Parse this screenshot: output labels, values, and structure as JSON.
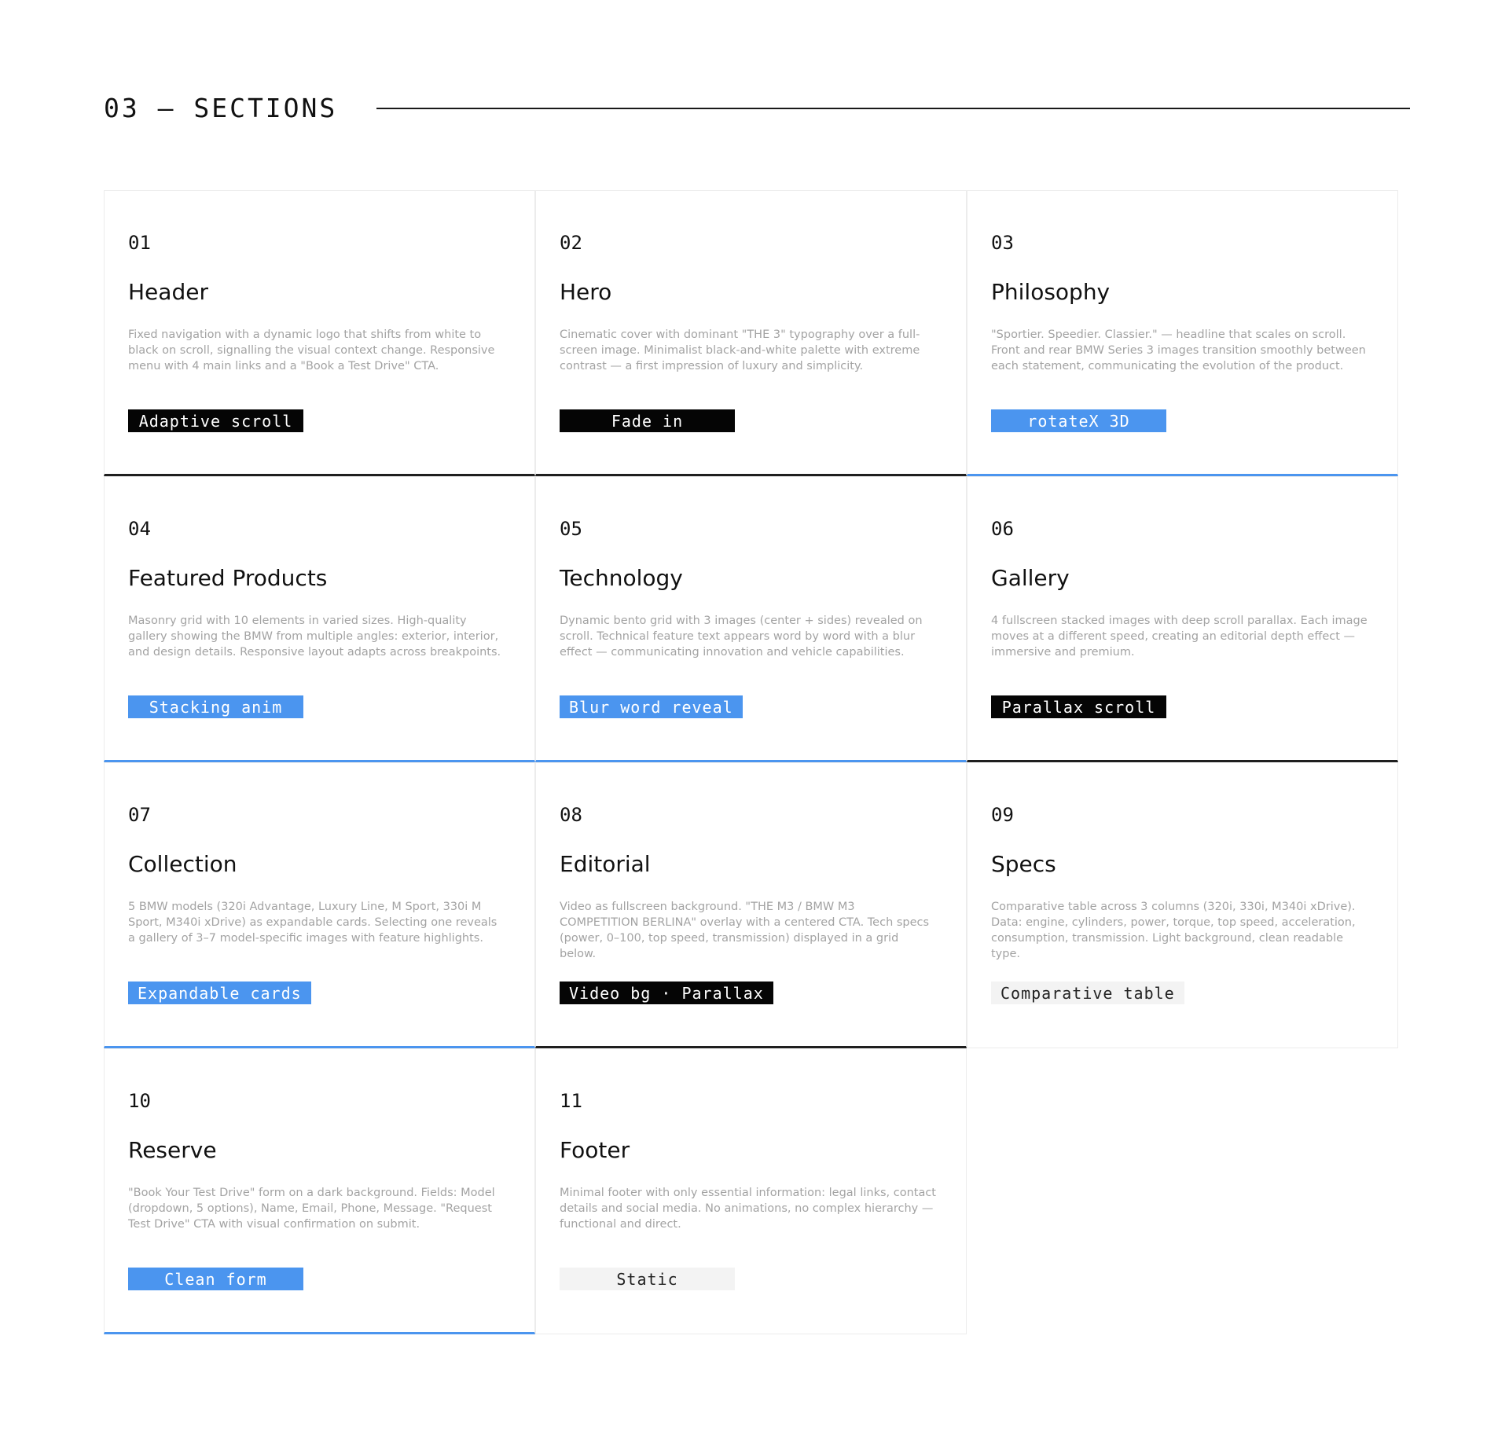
{
  "section": {
    "title": "03 — SECTIONS"
  },
  "cards": [
    {
      "num": "01",
      "title": "Header",
      "desc": "Fixed navigation with a dynamic logo that shifts from white to black on scroll, signalling the visual context change. Responsive menu with 4 main links and a \"Book a Test Drive\" CTA.",
      "tag": "Adaptive scroll"
    },
    {
      "num": "02",
      "title": "Hero",
      "desc": "Cinematic cover with dominant \"THE 3\" typography over a full-screen image. Minimalist black-and-white palette with extreme contrast — a first impression of luxury and simplicity.",
      "tag": "Fade in"
    },
    {
      "num": "03",
      "title": "Philosophy",
      "desc": "\"Sportier. Speedier. Classier.\" — headline that scales on scroll. Front and rear BMW Series 3 images transition smoothly between each statement, communicating the evolution of the product.",
      "tag": "rotateX 3D"
    },
    {
      "num": "04",
      "title": "Featured Products",
      "desc": "Masonry grid with 10 elements in varied sizes. High-quality gallery showing the BMW from multiple angles: exterior, interior, and design details. Responsive layout adapts across breakpoints.",
      "tag": "Stacking anim"
    },
    {
      "num": "05",
      "title": "Technology",
      "desc": "Dynamic bento grid with 3 images (center + sides) revealed on scroll. Technical feature text appears word by word with a blur effect — communicating innovation and vehicle capabilities.",
      "tag": "Blur word reveal"
    },
    {
      "num": "06",
      "title": "Gallery",
      "desc": "4 fullscreen stacked images with deep scroll parallax. Each image moves at a different speed, creating an editorial depth effect — immersive and premium.",
      "tag": "Parallax scroll"
    },
    {
      "num": "07",
      "title": "Collection",
      "desc": "5 BMW models (320i Advantage, Luxury Line, M Sport, 330i M Sport, M340i xDrive) as expandable cards. Selecting one reveals a gallery of 3–7 model-specific images with feature highlights.",
      "tag": "Expandable cards"
    },
    {
      "num": "08",
      "title": "Editorial",
      "desc": "Video as fullscreen background. \"THE M3 / BMW M3 COMPETITION BERLINA\" overlay with a centered CTA. Tech specs (power, 0–100, top speed, transmission) displayed in a grid below.",
      "tag": "Video bg · Parallax"
    },
    {
      "num": "09",
      "title": "Specs",
      "desc": "Comparative table across 3 columns (320i, 330i, M340i xDrive). Data: engine, cylinders, power, torque, top speed, acceleration, consumption, transmission. Light background, clean readable type.",
      "tag": "Comparative table"
    },
    {
      "num": "10",
      "title": "Reserve",
      "desc": "\"Book Your Test Drive\" form on a dark background. Fields: Model (dropdown, 5 options), Name, Email, Phone, Message. \"Request Test Drive\" CTA with visual confirmation on submit.",
      "tag": "Clean form"
    },
    {
      "num": "11",
      "title": "Footer",
      "desc": "Minimal footer with only essential information: legal links, contact details and social media. No animations, no complex hierarchy — functional and direct.",
      "tag": "Static"
    }
  ],
  "colors": {
    "accent": "#4b95ef",
    "ink": "#050505",
    "muted": "#a3a3a3",
    "chip_light": "#f3f3f3"
  }
}
